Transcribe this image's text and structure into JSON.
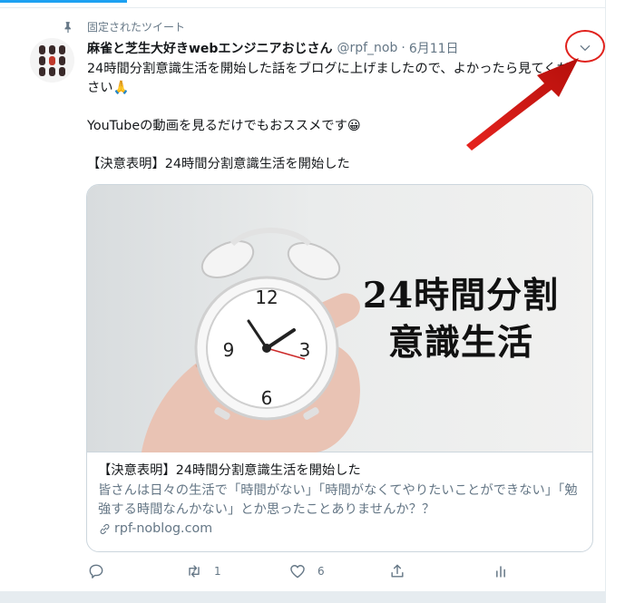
{
  "pinned_label": "固定されたツイート",
  "tweet": {
    "display_name": "麻雀と芝生大好きwebエンジニアおじさん",
    "handle": "@rpf_nob",
    "separator": "·",
    "date": "6月11日",
    "text": "24時間分割意識生活を開始した話をブログに上げましたので、よかったら見てください🙏\n\nYouTubeの動画を見るだけでもおススメです😀\n\n【決意表明】24時間分割意識生活を開始した"
  },
  "card": {
    "image_overlay_line1": "24時間分割",
    "image_overlay_line2": "意識生活",
    "title": "【決意表明】24時間分割意識生活を開始した",
    "description": "皆さんは日々の生活で「時間がない」「時間がなくてやりたいことができない」「勉強する時間なんかない」とか思ったことありませんか？？",
    "domain": "rpf-noblog.com"
  },
  "actions": {
    "reply_count": "",
    "retweet_count": "1",
    "like_count": "6"
  },
  "colors": {
    "accent": "#1da1f2",
    "secondary_text": "#657786",
    "annotation_red": "#e0211c"
  }
}
